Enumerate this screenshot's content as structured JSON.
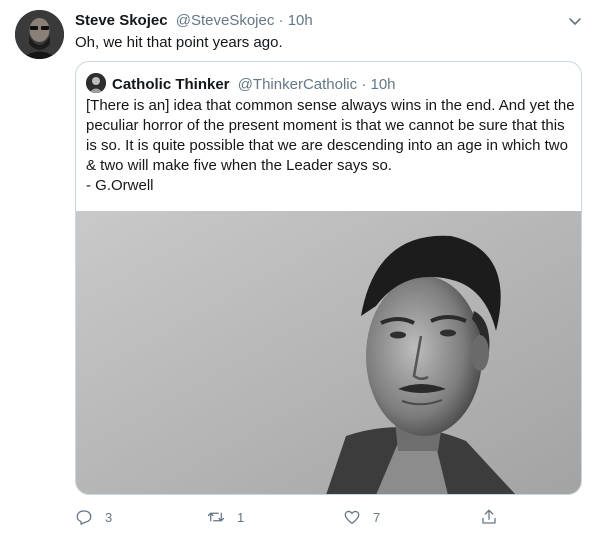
{
  "tweet": {
    "author_name": "Steve Skojec",
    "author_handle": "@SteveSkojec",
    "separator": "·",
    "time": "10h",
    "text": "Oh, we hit that point years ago."
  },
  "quoted": {
    "author_name": "Catholic Thinker",
    "author_handle": "@ThinkerCatholic",
    "separator": "·",
    "time": "10h",
    "lines": [
      "[There is an] idea that common sense always wins in the end. And yet the",
      "peculiar horror of the present moment is that we cannot be sure that this",
      "is so. It is quite possible that we are descending into an age in which two",
      "& two will make five when the Leader says so.",
      "- G.Orwell"
    ]
  },
  "actions": {
    "reply_count": "3",
    "retweet_count": "1",
    "like_count": "7"
  },
  "icons": {
    "caret": "chevron-down-icon",
    "reply": "reply-icon",
    "retweet": "retweet-icon",
    "like": "heart-icon",
    "share": "share-icon"
  },
  "colors": {
    "text": "#14171a",
    "secondary": "#657786",
    "border": "#ccd6dd"
  }
}
